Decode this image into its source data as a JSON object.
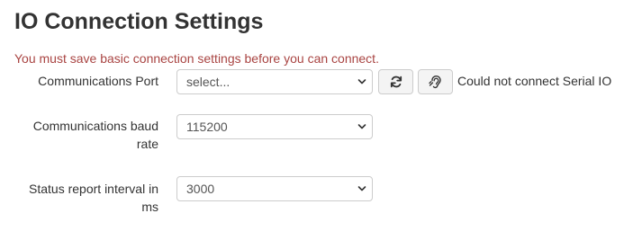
{
  "page": {
    "title": "IO Connection Settings",
    "warning": "You must save basic connection settings before you can connect."
  },
  "fields": {
    "port": {
      "label": "Communications Port",
      "value": "select...",
      "refresh_icon": "refresh-icon",
      "detect_icon": "hearing-icon",
      "status": "Could not connect Serial IO"
    },
    "baud": {
      "label_line1": "Communications baud",
      "label_line2": "rate",
      "value": "115200"
    },
    "interval": {
      "label_line1": "Status report interval in",
      "label_line2": "ms",
      "value": "3000"
    }
  },
  "colors": {
    "warning": "#a94442",
    "text": "#333333",
    "border": "#cccccc"
  }
}
